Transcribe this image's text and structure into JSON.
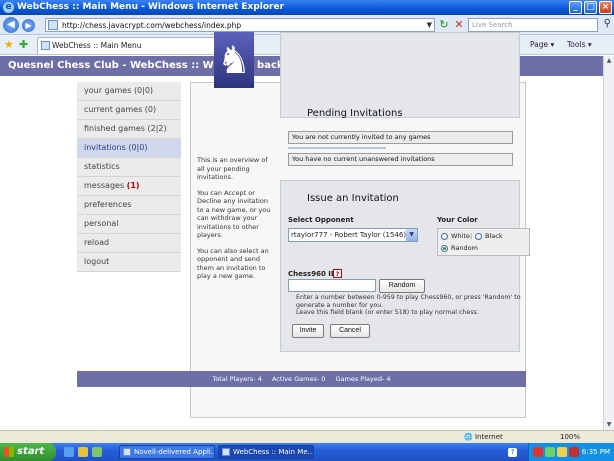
{
  "window": {
    "title": "WebChess :: Main Menu - Windows Internet Explorer"
  },
  "browser": {
    "url": "http://chess.javacrypt.com/webchess/index.php",
    "search_placeholder": "Live Search",
    "tab_title": "WebChess :: Main Menu",
    "page_label": "Page ▾",
    "tools_label": "Tools ▾"
  },
  "site": {
    "header": "Quesnel Chess Club - WebChess :: Welcome back, John"
  },
  "menu": {
    "items": [
      {
        "label": "your games (0|0)"
      },
      {
        "label": "current games (0)"
      },
      {
        "label": "finished games (2|2)"
      },
      {
        "label": "invitations (0|0)"
      },
      {
        "label": "statistics"
      },
      {
        "label": "messages",
        "count": "(1)"
      },
      {
        "label": "preferences"
      },
      {
        "label": "personal"
      },
      {
        "label": "reload"
      },
      {
        "label": "logout"
      }
    ]
  },
  "info": {
    "p1": "This is an overview of all your pending invitations.",
    "p2": "You can Accept or Decline any invitation to a new game, or you can withdraw your invitations to other players.",
    "p3": "You can also select an opponent and send them an invitation to play a new game."
  },
  "pending": {
    "title": "Pending Invitations",
    "msg1": "You are not currently invited to any games",
    "msg2": "You have no current unanswered invitations"
  },
  "issue": {
    "title": "Issue an Invitation",
    "select_opponent_label": "Select Opponent",
    "opponent_value": "rtaylor777 - Robert Taylor (1546)",
    "your_color_label": "Your Color",
    "color_options": {
      "white": "White",
      "black": "Black",
      "random": "Random"
    },
    "color_selected": "Random",
    "chess960_label": "Chess960 ID",
    "help_icon": "?",
    "random_button": "Random",
    "help_text": "Enter a number between 0-959 to play Chess960, or press 'Random' to generate a number for you.",
    "help_text2": "Leave this field blank (or enter 518) to play normal chess.",
    "invite_button": "Invite",
    "cancel_button": "Cancel"
  },
  "footer": {
    "total_players": "Total Players- 4",
    "active_games": "Active Games- 0",
    "games_played": "Games Played- 4"
  },
  "statusbar": {
    "zone": "Internet",
    "zoom": "100%"
  },
  "taskbar": {
    "start": "start",
    "task1": "Novell-delivered Appli...",
    "task2": "WebChess :: Main Me...",
    "clock": "6:35 PM"
  },
  "icons": {
    "browser_logo": "ie-logo-icon",
    "back": "back-arrow-icon",
    "forward": "forward-arrow-icon",
    "knight": "chess-knight-icon",
    "search": "search-icon"
  },
  "colors": {
    "header_bg": "#6f6fa8",
    "menu_active": "#cfd7ea",
    "messages_count": "#c00000"
  }
}
